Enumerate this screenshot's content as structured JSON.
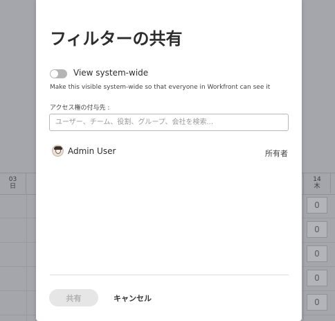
{
  "background": {
    "day_headers": [
      {
        "date": "03",
        "weekday": "日"
      },
      {
        "date": "14",
        "weekday": "木"
      }
    ],
    "cell_values": [
      "0",
      "0",
      "0",
      "0",
      "0"
    ]
  },
  "dialog": {
    "title": "フィルターの共有",
    "toggle": {
      "label": "View system-wide",
      "on": false
    },
    "description": "Make this visible system-wide so that everyone in Workfront can see it",
    "access_label": "アクセス権の付与先 :",
    "search": {
      "placeholder": "ユーザー、チーム、役割、グループ、会社を検索...",
      "value": ""
    },
    "users": [
      {
        "name": "Admin User",
        "role": "所有者"
      }
    ],
    "footer": {
      "share_label": "共有",
      "share_enabled": false,
      "cancel_label": "キャンセル"
    }
  },
  "colors": {
    "overlay": "#a4a6ac",
    "dialog_bg": "#ffffff",
    "toggle_off": "#b5b5b5",
    "disabled_button_bg": "#e6e6e6",
    "disabled_button_text": "#b0b0b0"
  }
}
